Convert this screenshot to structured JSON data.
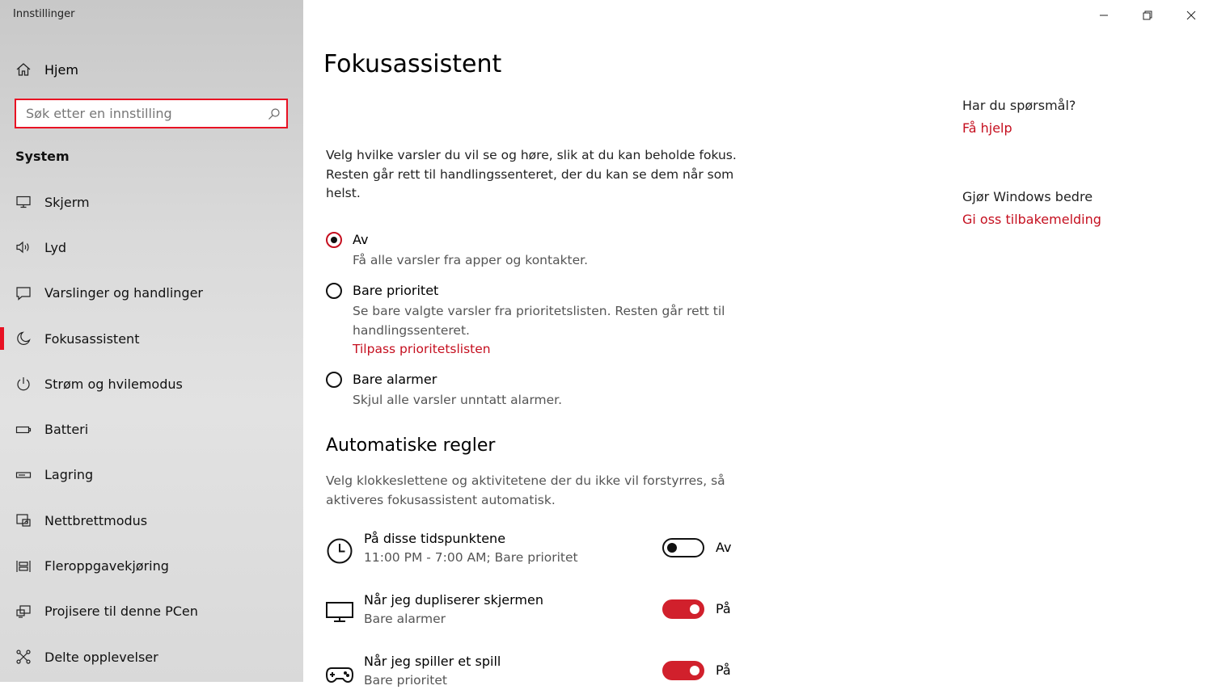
{
  "app": {
    "title": "Innstillinger"
  },
  "window_controls": {
    "minimize_icon": "minimize-icon",
    "restore_icon": "restore-icon",
    "close_icon": "close-icon"
  },
  "sidebar": {
    "home_label": "Hjem",
    "search_placeholder": "Søk etter en innstilling",
    "section_title": "System",
    "items": [
      {
        "label": "Skjerm",
        "icon": "monitor-icon"
      },
      {
        "label": "Lyd",
        "icon": "speaker-icon"
      },
      {
        "label": "Varslinger og handlinger",
        "icon": "notification-icon"
      },
      {
        "label": "Fokusassistent",
        "icon": "moon-icon",
        "active": true
      },
      {
        "label": "Strøm og hvilemodus",
        "icon": "power-icon"
      },
      {
        "label": "Batteri",
        "icon": "battery-icon"
      },
      {
        "label": "Lagring",
        "icon": "storage-icon"
      },
      {
        "label": "Nettbrettmodus",
        "icon": "tablet-mode-icon"
      },
      {
        "label": "Fleroppgavekjøring",
        "icon": "multitasking-icon"
      },
      {
        "label": "Projisere til denne PCen",
        "icon": "project-icon"
      },
      {
        "label": "Delte opplevelser",
        "icon": "shared-experiences-icon"
      }
    ]
  },
  "main": {
    "title": "Fokusassistent",
    "intro": "Velg hvilke varsler du vil se og høre, slik at du kan beholde fokus. Resten går rett til handlingssenteret, der du kan se dem når som helst.",
    "options": [
      {
        "label": "Av",
        "desc": "Få alle varsler fra apper og kontakter.",
        "checked": true
      },
      {
        "label": "Bare prioritet",
        "desc": "Se bare valgte varsler fra prioritetslisten. Resten går rett til handlingssenteret.",
        "link": "Tilpass prioritetslisten",
        "checked": false
      },
      {
        "label": "Bare alarmer",
        "desc": "Skjul alle varsler unntatt alarmer.",
        "checked": false
      }
    ],
    "auto_rules": {
      "heading": "Automatiske regler",
      "desc": "Velg klokkeslettene og aktivitetene der du ikke vil forstyrres, så aktiveres fokusassistent automatisk.",
      "rules": [
        {
          "title": "På disse tidspunktene",
          "sub": "11:00 PM - 7:00 AM; Bare prioritet",
          "state": "Av",
          "on": false,
          "icon": "clock-icon"
        },
        {
          "title": "Når jeg dupliserer skjermen",
          "sub": "Bare alarmer",
          "state": "På",
          "on": true,
          "icon": "monitor-icon"
        },
        {
          "title": "Når jeg spiller et spill",
          "sub": "Bare prioritet",
          "state": "På",
          "on": true,
          "icon": "gamepad-icon"
        }
      ]
    }
  },
  "right": {
    "help_heading": "Har du spørsmål?",
    "help_link": "Få hjelp",
    "feedback_heading": "Gjør Windows bedre",
    "feedback_link": "Gi oss tilbakemelding"
  },
  "colors": {
    "accent": "#e81123",
    "link": "#c50f1f",
    "toggle_on": "#d1202c"
  }
}
